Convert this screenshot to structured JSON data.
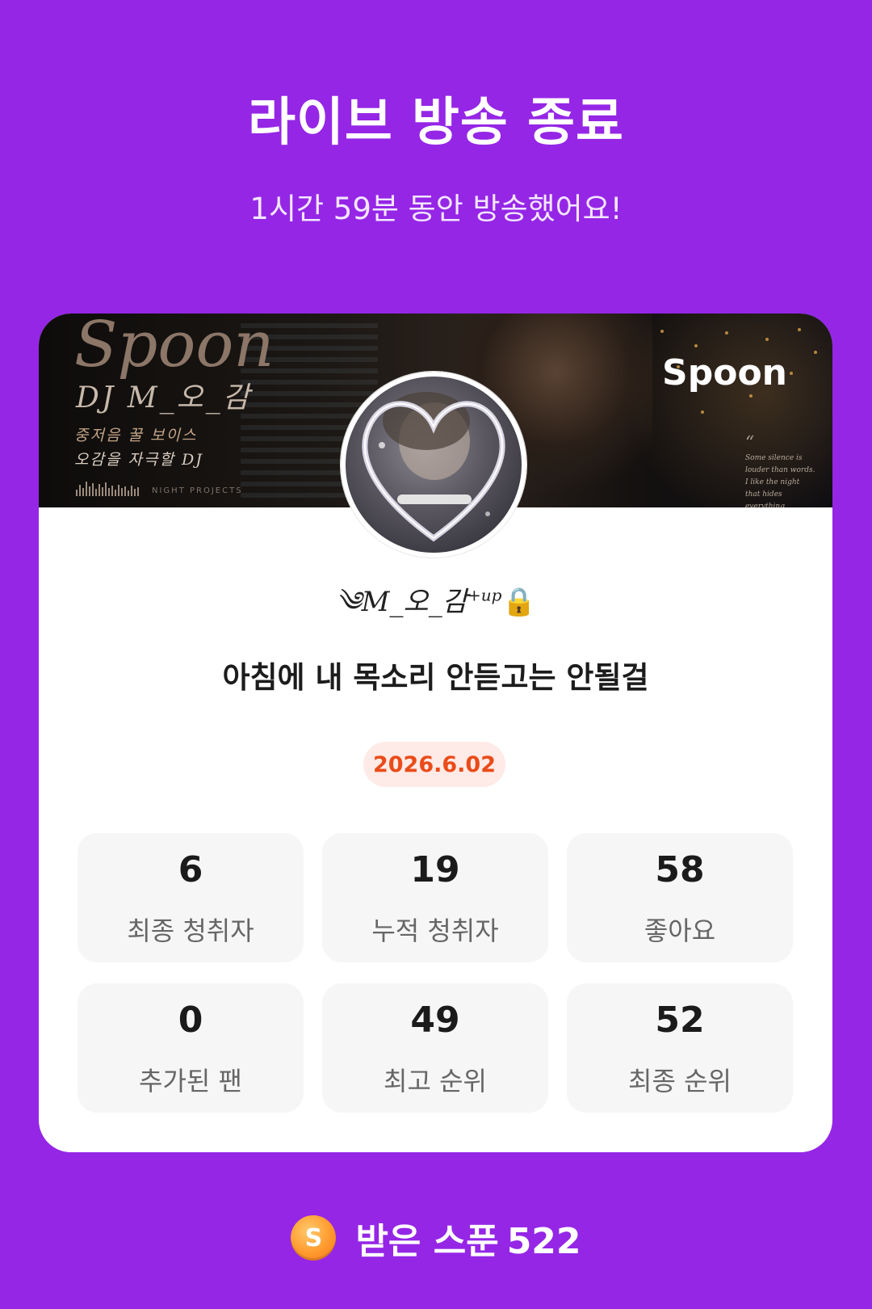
{
  "header": {
    "title": "라이브 방송 종료",
    "subtitle": "1시간 59분 동안 방송했어요!"
  },
  "banner": {
    "logo_text": "Spoon",
    "dj_text": "DJ M_오_감",
    "line1": "중저음 꿀 보이스",
    "line2": "오감을 자극할 DJ",
    "tag": "NIGHT PROJECTS",
    "brand": "Spoon",
    "quote_mark": "“",
    "quote_lines": [
      "Some silence is",
      "louder than words.",
      "I like the night",
      "that hides everything"
    ]
  },
  "profile": {
    "name": "༄M_오_감",
    "name_suffix": "+up",
    "lock_glyph": "🔒"
  },
  "live": {
    "title": "아침에 내 목소리 안듣고는 안될걸",
    "date": "2026.6.02"
  },
  "stats": [
    {
      "value": "6",
      "label": "최종 청취자"
    },
    {
      "value": "19",
      "label": "누적 청취자"
    },
    {
      "value": "58",
      "label": "좋아요"
    },
    {
      "value": "0",
      "label": "추가된 팬"
    },
    {
      "value": "49",
      "label": "최고 순위"
    },
    {
      "value": "52",
      "label": "최종 순위"
    }
  ],
  "footer": {
    "coin_letter": "S",
    "label": "받은 스푼",
    "value": "522"
  },
  "colors": {
    "background": "#9526e6",
    "card": "#ffffff",
    "date_badge_bg": "#feeae6",
    "date_badge_text": "#ea4b19",
    "coin": "#ff9a2e"
  },
  "icons": {
    "coin": "spoon-coin-icon",
    "lock": "lock-icon"
  }
}
